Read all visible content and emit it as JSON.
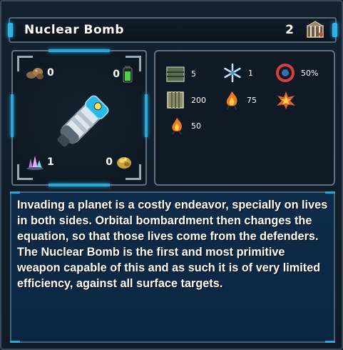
{
  "header": {
    "title": "Nuclear Bomb",
    "count": "2",
    "icon": "cage-icon"
  },
  "resources": {
    "top_left": {
      "icon": "ore-rocks-icon",
      "value": "0"
    },
    "top_right": {
      "icon": "energy-cell-icon",
      "value": "0"
    },
    "bottom_left": {
      "icon": "crystal-icon",
      "value": "1"
    },
    "bottom_right": {
      "icon": "gold-ore-icon",
      "value": "0"
    }
  },
  "item_image": "nuclear-bomb-canister",
  "stats": [
    {
      "icon": "armor-crate-icon",
      "value": "5"
    },
    {
      "icon": "snowflake-icon",
      "value": "1"
    },
    {
      "icon": "red-ring-icon",
      "value": "50%"
    },
    {
      "icon": "cargo-container-icon",
      "value": "200"
    },
    {
      "icon": "fire-creature-icon",
      "value": "75"
    },
    {
      "icon": "explosion-icon",
      "value": ""
    },
    {
      "icon": "fire-creature-small-icon",
      "value": "50"
    }
  ],
  "description": "Invading a planet is a costly endeavor, specially on lives in both sides. Orbital bombardment then changes the equation, so that those lives come from the defenders. The Nuclear Bomb is the first and most primitive weapon capable of this and as such it is of very limited efficiency, against all surface targets.",
  "colors": {
    "accent": "#2aa6d8",
    "panel_border": "#607282",
    "description_bg": "#0e2d4a"
  }
}
